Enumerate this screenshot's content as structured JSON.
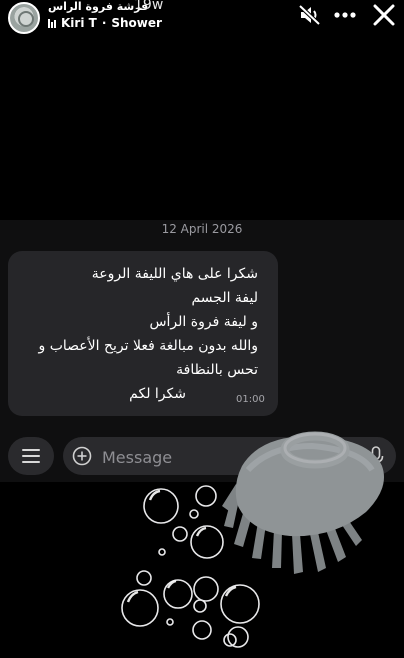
{
  "story": {
    "title": "فرشة فروة الراس",
    "age": "19w",
    "music_artist": "Kiri T",
    "music_separator": "·",
    "music_track": "Shower",
    "icons": [
      "avatar",
      "music-bars-icon",
      "mute-icon",
      "more-icon",
      "close-icon"
    ]
  },
  "chat": {
    "date": "12 April 2026",
    "message": {
      "lines": [
        "شكرا على هاي الليفة الروعة",
        "ليفة الجسم",
        "و ليفة فروة الرأس",
        "والله بدون مبالغة فعلا تريح الأعصاب و",
        "تحس بالنظافة",
        "شكرا لكم"
      ],
      "time": "01:00"
    },
    "input": {
      "placeholder": "Message",
      "icons": [
        "menu-icon",
        "plus-icon",
        "mic-icon"
      ]
    }
  },
  "colors": {
    "background": "#000000",
    "panel": "#0f0f10",
    "bubble": "#262629",
    "input_bg": "#2a2a2d",
    "brush": "#8f9496"
  },
  "sticker": {
    "name": "scalp-brush-with-bubbles"
  }
}
